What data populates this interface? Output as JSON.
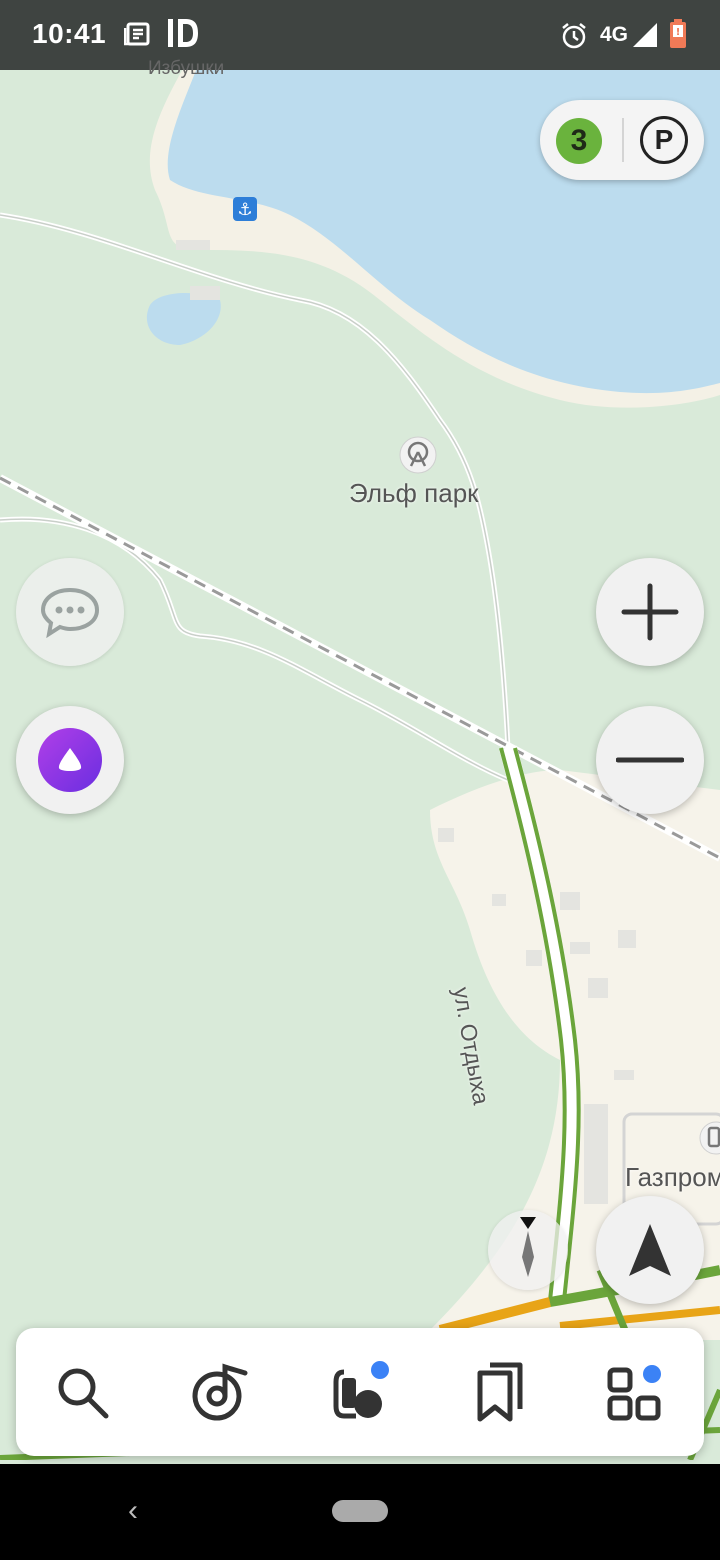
{
  "status_bar": {
    "time": "10:41",
    "network": "4G",
    "icons": [
      "news-icon",
      "id-icon",
      "alarm-icon",
      "signal-icon",
      "battery-icon"
    ]
  },
  "map": {
    "labels": {
      "village": "Избушки",
      "park": "Эльф парк",
      "street": "ул. Отдыха",
      "gas_station": "Газпром"
    },
    "colors": {
      "land": "#d9ead9",
      "water": "#bcdcee",
      "settlement": "#f6f3ea",
      "road_traffic": "#6ba53b",
      "highway": "#e8a417"
    }
  },
  "controls": {
    "traffic_score": "3",
    "parking_label": "P"
  },
  "bottom_panel": {
    "tabs": [
      "search",
      "music",
      "fuel",
      "bookmarks",
      "services"
    ]
  }
}
